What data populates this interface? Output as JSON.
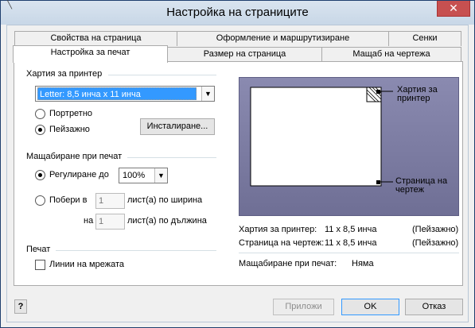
{
  "window": {
    "title": "Настройка на страниците",
    "close_label": "✕"
  },
  "tabs_top": [
    {
      "label": "Свойства на страница"
    },
    {
      "label": "Оформление и маршрутизиране"
    },
    {
      "label": "Сенки"
    }
  ],
  "tabs_bottom": [
    {
      "label": "Настройка за печат",
      "active": true
    },
    {
      "label": "Размер на страница"
    },
    {
      "label": "Мащаб на чертежа"
    }
  ],
  "printer_paper": {
    "group_label": "Хартия за принтер",
    "selected": "Letter:  8,5 инча х 11 инча",
    "portrait_label": "Портретно",
    "landscape_label": "Пейзажно",
    "orientation": "landscape",
    "setup_button": "Инсталиране..."
  },
  "print_zoom": {
    "group_label": "Мащабиране при печат",
    "adjust_label": "Регулиране до",
    "adjust_value": "100%",
    "fit_label": "Побери в",
    "fit_width_value": "1",
    "fit_width_suffix": "лист(а) по ширина",
    "on_label": "на",
    "fit_height_value": "1",
    "fit_height_suffix": "лист(а) по дължина",
    "mode": "adjust"
  },
  "print": {
    "group_label": "Печат",
    "gridlines_label": "Линии на мрежата",
    "gridlines_checked": false
  },
  "preview": {
    "printer_paper_label": "Хартия за принтер",
    "drawing_page_label": "Страница на чертеж"
  },
  "info": {
    "paper_label": "Хартия за принтер:",
    "paper_value": "11 х 8,5 инча",
    "paper_orient": "(Пейзажно)",
    "page_label": "Страница на чертеж:",
    "page_value": "11 х 8,5 инча",
    "page_orient": "(Пейзажно)",
    "zoom_label": "Мащабиране при печат:",
    "zoom_value": "Няма"
  },
  "footer": {
    "help_icon": "?",
    "apply": "Приложи",
    "ok": "OK",
    "cancel": "Отказ"
  }
}
